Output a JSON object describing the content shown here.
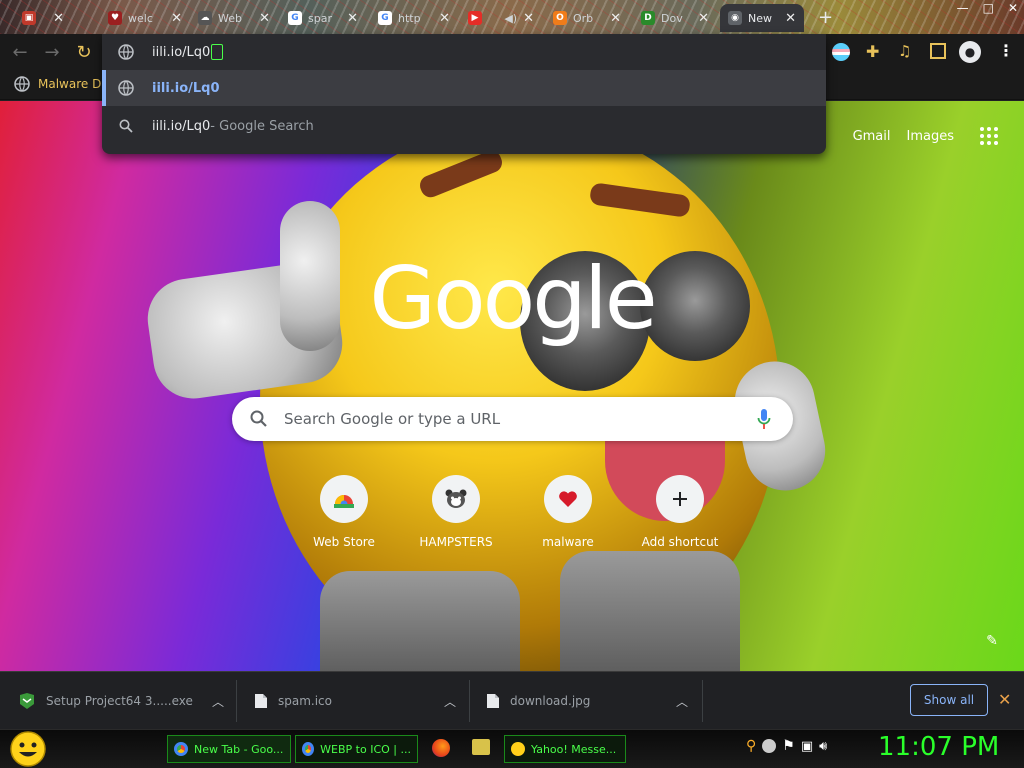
{
  "tabs": [
    {
      "title": "",
      "active": false
    },
    {
      "title": "welc",
      "active": false
    },
    {
      "title": "Web",
      "active": false
    },
    {
      "title": "spar",
      "active": false
    },
    {
      "title": "http",
      "active": false
    },
    {
      "title": "",
      "active": false
    },
    {
      "title": "Orb",
      "active": false
    },
    {
      "title": "Dov",
      "active": false
    },
    {
      "title": "New",
      "active": true
    }
  ],
  "window_controls": {
    "minimize": "—",
    "maximize": "□",
    "close": "✕"
  },
  "toolbar": {
    "address_text": "iili.io/Lq0"
  },
  "bookmarks": [
    {
      "label": "Malware Da"
    }
  ],
  "omnibox": {
    "suggestions": [
      {
        "text": "iili.io/Lq0",
        "suffix": "",
        "icon": "globe"
      },
      {
        "text": "iili.io/Lq0",
        "suffix": " - Google Search",
        "icon": "search"
      }
    ]
  },
  "ntp": {
    "gmail": "Gmail",
    "images": "Images",
    "logo": "Google",
    "search_placeholder": "Search Google or type a URL",
    "shortcuts": [
      {
        "label": "Web Store",
        "icon": "webstore-icon"
      },
      {
        "label": "HAMPSTERS",
        "icon": "hamster-icon"
      },
      {
        "label": "malware",
        "icon": "heart-icon"
      },
      {
        "label": "Add shortcut",
        "icon": "plus-icon"
      }
    ]
  },
  "downloads": {
    "items": [
      {
        "name": "Setup Project64 3.....exe"
      },
      {
        "name": "spam.ico"
      },
      {
        "name": "download.jpg"
      }
    ],
    "show_all": "Show all"
  },
  "taskbar": {
    "items": [
      {
        "label": "New Tab - Goo..."
      },
      {
        "label": "WEBP to ICO | ..."
      },
      {
        "label": "Yahoo! Messe..."
      }
    ],
    "clock": "11:07 PM"
  },
  "colors": {
    "accent": "#8ab4f8",
    "taskbar_green": "#2aff2a",
    "bookmark_text": "#e8c25a"
  }
}
